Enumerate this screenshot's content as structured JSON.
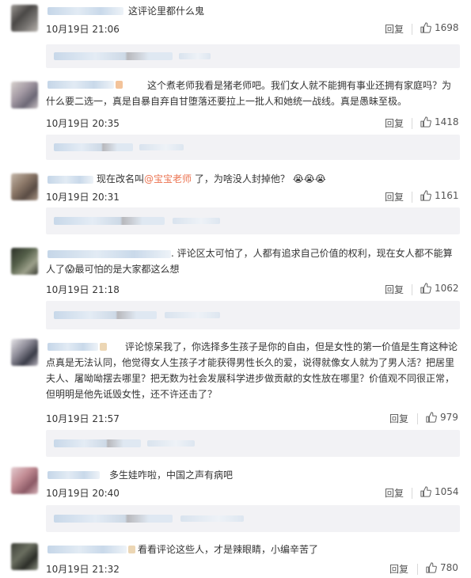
{
  "comments": [
    {
      "text": "这评论里都什么鬼",
      "date": "10月19日 21:06",
      "reply": "回复",
      "likes": "1698"
    },
    {
      "text": "这个煮老师我看是猪老师吧。我们女人就不能拥有事业还拥有家庭吗？为什么要二选一，真是自暴自弃自甘堕落还要拉上一批人和她统一战线。真是愚昧至极。",
      "date": "10月19日 20:35",
      "reply": "回复",
      "likes": "1418"
    },
    {
      "text_before": "现在改名叫",
      "mention": "@宝宝老师",
      "text_after": " 了，为啥没人封掉他？",
      "emoji": "😭😭😭",
      "date": "10月19日 20:31",
      "reply": "回复",
      "likes": "1161"
    },
    {
      "text_before": ". 评论区太可怕了，人都有追求自己价值的权利，现在女人都不能算人了",
      "emoji": "😱",
      "text_after": "最可怕的是大家都这么想",
      "date": "10月19日 21:18",
      "reply": "回复",
      "likes": "1062"
    },
    {
      "text": "评论惊呆我了，你选择多生孩子是你的自由，但是女性的第一价值是生育这种论点真是无法认同，他觉得女人生孩子才能获得男性长久的爱，说得就像女人就为了男人活？把居里夫人、屠呦呦摆去哪里？把无数为社会发展科学进步做贡献的女性放在哪里？价值观不同很正常，但明明是他先诋毁女性，还不许还击了？",
      "date": "10月19日 21:57",
      "reply": "回复",
      "likes": "979"
    },
    {
      "text": "多生娃咋啦，中国之声有病吧",
      "date": "10月19日 20:40",
      "reply": "回复",
      "likes": "1054"
    },
    {
      "text": "看看评论这些人，才是辣眼睛，小编辛苦了",
      "date": "10月19日 21:32",
      "reply": "回复",
      "likes": "780"
    }
  ]
}
